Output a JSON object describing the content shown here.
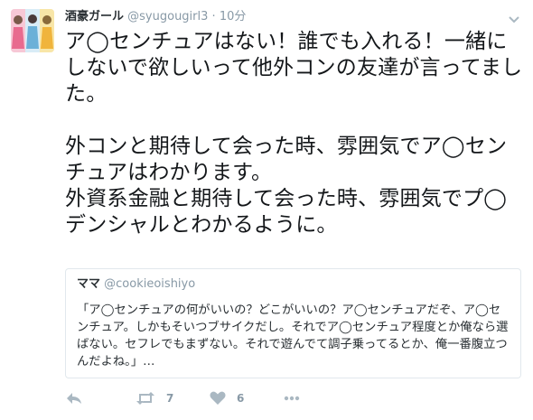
{
  "tweet": {
    "display_name": "酒豪ガール",
    "screen_name": "@syugougirl3",
    "separator": "·",
    "time": "10分",
    "body": {
      "p1": "ア◯センチュアはない！誰でも入れる！一緒にしないで欲しいって他外コンの友達が言ってました。",
      "p2": "外コンと期待して会った時、雰囲気でア◯センチュアはわかります。",
      "p3": "外資系金融と期待して会った時、雰囲気でプ◯デンシャルとわかるように。"
    }
  },
  "quote": {
    "display_name": "ママ",
    "screen_name": "@cookieoishiyo",
    "text": "「ア◯センチュアの何がいいの？どこがいいの？ア◯センチュアだぞ、ア◯センチュア。しかもそいつブサイクだし。それでア◯センチュア程度とか俺なら選ばない。セフレでもまずない。それで遊んでて調子乗ってるとか、俺一番腹立つんだよね。」…"
  },
  "actions": {
    "retweet_count": "7",
    "like_count": "6"
  },
  "icons": [
    "reply-icon",
    "retweet-icon",
    "like-icon",
    "more-icon",
    "caret-down-icon"
  ],
  "colors": {
    "text": "#14171a",
    "muted": "#8899a6",
    "border": "#e1e8ed",
    "icon": "#aab8c2"
  }
}
